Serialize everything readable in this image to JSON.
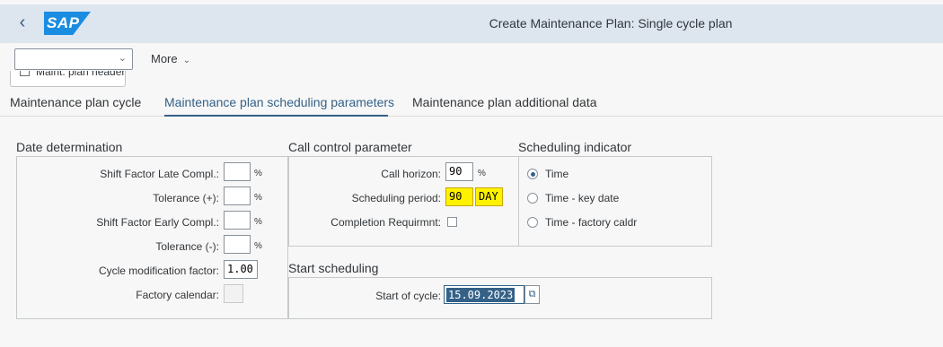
{
  "header": {
    "title": "Create Maintenance Plan: Single cycle plan",
    "logo_text": "SAP",
    "back_icon": "chevron-left-icon"
  },
  "toolbar": {
    "combo_value": "",
    "more_label": "More",
    "header_button_label": "Maint. plan header"
  },
  "tabs": [
    {
      "label": "Maintenance plan cycle"
    },
    {
      "label": "Maintenance plan scheduling parameters"
    },
    {
      "label": "Maintenance plan additional data"
    }
  ],
  "date_determination": {
    "title": "Date determination",
    "fields": [
      {
        "label": "Shift Factor Late Compl.:",
        "value": "",
        "unit": "%"
      },
      {
        "label": "Tolerance (+):",
        "value": "",
        "unit": "%"
      },
      {
        "label": "Shift Factor Early Compl.:",
        "value": "",
        "unit": "%"
      },
      {
        "label": "Tolerance (-):",
        "value": "",
        "unit": "%"
      },
      {
        "label": "Cycle modification factor:",
        "value": "1.00"
      },
      {
        "label": "Factory calendar:",
        "value": ""
      }
    ]
  },
  "call_control": {
    "title": "Call control parameter",
    "call_horizon_label": "Call horizon:",
    "call_horizon_value": "90",
    "call_horizon_unit": "%",
    "sched_period_label": "Scheduling period:",
    "sched_period_value": "90",
    "sched_period_unit": "DAY",
    "completion_label": "Completion Requirmnt:",
    "completion_checked": false
  },
  "scheduling_indicator": {
    "title": "Scheduling indicator",
    "options": [
      {
        "label": "Time",
        "selected": true
      },
      {
        "label": "Time - key date",
        "selected": false
      },
      {
        "label": "Time - factory caldr",
        "selected": false
      }
    ]
  },
  "start_scheduling": {
    "title": "Start scheduling",
    "start_label": "Start of cycle:",
    "start_value": "15.09.2023"
  },
  "colors": {
    "header_bg": "#dde5ef",
    "accent": "#346187",
    "highlight": "#fff200",
    "logo": "#1a8de0"
  }
}
